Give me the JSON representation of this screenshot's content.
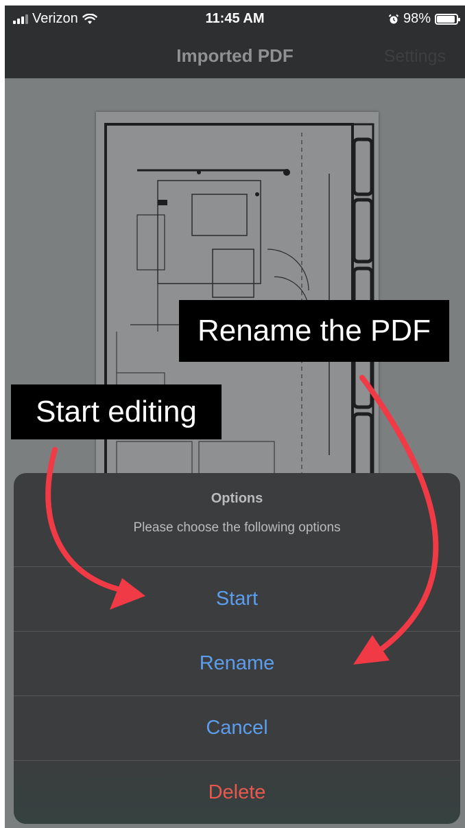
{
  "status_bar": {
    "carrier": "Verizon",
    "time": "11:45 AM",
    "battery": "98%",
    "icons": [
      "signal-icon",
      "wifi-icon",
      "alarm-icon",
      "battery-icon"
    ]
  },
  "nav": {
    "title": "Imported PDF",
    "settings_label": "Settings"
  },
  "annotations": {
    "rename_callout": "Rename the PDF",
    "start_callout": "Start editing"
  },
  "action_sheet": {
    "title": "Options",
    "message": "Please choose the following options",
    "buttons": [
      {
        "label": "Start"
      },
      {
        "label": "Rename"
      },
      {
        "label": "Cancel"
      },
      {
        "label": "Delete"
      }
    ]
  },
  "colors": {
    "action_blue": "#5c9ded",
    "destructive_red": "#e8584e",
    "arrow_red": "#f03a46"
  }
}
